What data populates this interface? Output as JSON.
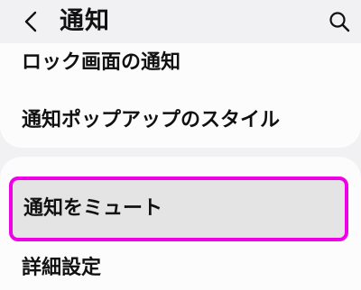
{
  "header": {
    "title": "通知",
    "back_icon": "chevron-left-icon",
    "search_icon": "search-icon"
  },
  "settings": {
    "lock_screen_notifications": "ロック画面の通知",
    "popup_style": "通知ポップアップのスタイル",
    "mute_notifications": "通知をミュート",
    "advanced_settings": "詳細設定"
  },
  "colors": {
    "highlight_border": "#f000e6",
    "selected_bg": "#e4e4e4",
    "page_bg": "#f1f1f3",
    "card_bg": "#fcfcfc"
  }
}
